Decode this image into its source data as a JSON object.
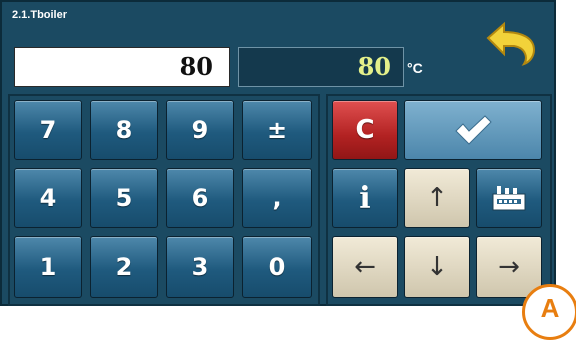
{
  "header": {
    "title": "2.1.Tboiler",
    "back_icon": "undo-arrow-icon"
  },
  "input": {
    "value": "80"
  },
  "current": {
    "value": "80",
    "unit": "°C"
  },
  "keypad": {
    "keys": [
      "7",
      "8",
      "9",
      "±",
      "4",
      "5",
      "6",
      ",",
      "1",
      "2",
      "3",
      "0"
    ]
  },
  "actions": {
    "clear_label": "C",
    "confirm_icon": "checkmark-icon",
    "info_label": "i",
    "up_label": "↑",
    "menu_icon": "device-settings-icon",
    "left_label": "←",
    "down_label": "↓",
    "right_label": "→"
  },
  "badge": {
    "label": "A"
  },
  "colors": {
    "background": "#1b4a62",
    "key_blue": "#1f5a7e",
    "key_light": "#e6dfc7",
    "clear_red": "#b22222",
    "display_text": "#e3f08a",
    "badge_orange": "#e87e10"
  }
}
